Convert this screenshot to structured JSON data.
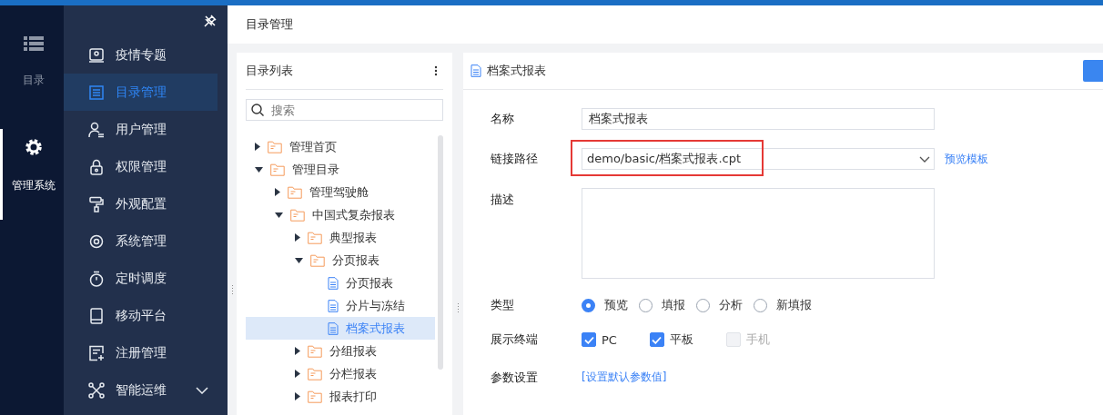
{
  "rail": [
    {
      "label": "目录",
      "selected": false
    },
    {
      "label": "管理系统",
      "selected": true
    }
  ],
  "nav": {
    "items": [
      {
        "label": "疫情专题",
        "selected": false
      },
      {
        "label": "目录管理",
        "selected": true
      },
      {
        "label": "用户管理",
        "selected": false
      },
      {
        "label": "权限管理",
        "selected": false
      },
      {
        "label": "外观配置",
        "selected": false
      },
      {
        "label": "系统管理",
        "selected": false
      },
      {
        "label": "定时调度",
        "selected": false
      },
      {
        "label": "移动平台",
        "selected": false
      },
      {
        "label": "注册管理",
        "selected": false
      },
      {
        "label": "智能运维",
        "selected": false,
        "expandable": true
      }
    ]
  },
  "header": {
    "title": "目录管理"
  },
  "tree_panel": {
    "title": "目录列表",
    "search": {
      "placeholder": "搜索"
    },
    "items": [
      {
        "label": "管理首页",
        "kind": "folder",
        "expanded": false,
        "selected": false
      },
      {
        "label": "管理目录",
        "kind": "folder",
        "expanded": true,
        "selected": false,
        "children": [
          {
            "label": "管理驾驶舱",
            "kind": "folder",
            "expanded": false,
            "selected": false
          },
          {
            "label": "中国式复杂报表",
            "kind": "folder",
            "expanded": true,
            "selected": false,
            "children": [
              {
                "label": "典型报表",
                "kind": "folder",
                "expanded": false,
                "selected": false
              },
              {
                "label": "分页报表",
                "kind": "folder",
                "expanded": true,
                "selected": false,
                "children": [
                  {
                    "label": "分页报表",
                    "kind": "file",
                    "selected": false
                  },
                  {
                    "label": "分片与冻结",
                    "kind": "file",
                    "selected": false
                  },
                  {
                    "label": "档案式报表",
                    "kind": "file",
                    "selected": true
                  }
                ]
              },
              {
                "label": "分组报表",
                "kind": "folder",
                "expanded": false,
                "selected": false
              },
              {
                "label": "分栏报表",
                "kind": "folder",
                "expanded": false,
                "selected": false
              },
              {
                "label": "报表打印",
                "kind": "folder",
                "expanded": false,
                "selected": false
              }
            ]
          }
        ]
      }
    ]
  },
  "detail": {
    "title": "档案式报表",
    "form": {
      "name": {
        "label": "名称",
        "value": "档案式报表"
      },
      "path": {
        "label": "链接路径",
        "value": "demo/basic/档案式报表.cpt",
        "highlighted": true,
        "link": "预览模板"
      },
      "description": {
        "label": "描述"
      },
      "type": {
        "label": "类型",
        "options": [
          {
            "label": "预览",
            "selected": true
          },
          {
            "label": "填报",
            "selected": false
          },
          {
            "label": "分析",
            "selected": false
          },
          {
            "label": "新填报",
            "selected": false
          }
        ]
      },
      "terminals": {
        "label": "展示终端",
        "options": [
          {
            "label": "PC",
            "checked": true,
            "disabled": false
          },
          {
            "label": "平板",
            "checked": true,
            "disabled": false
          },
          {
            "label": "手机",
            "checked": false,
            "disabled": true
          }
        ]
      },
      "params": {
        "label": "参数设置",
        "link": "[设置默认参数值]"
      }
    }
  }
}
